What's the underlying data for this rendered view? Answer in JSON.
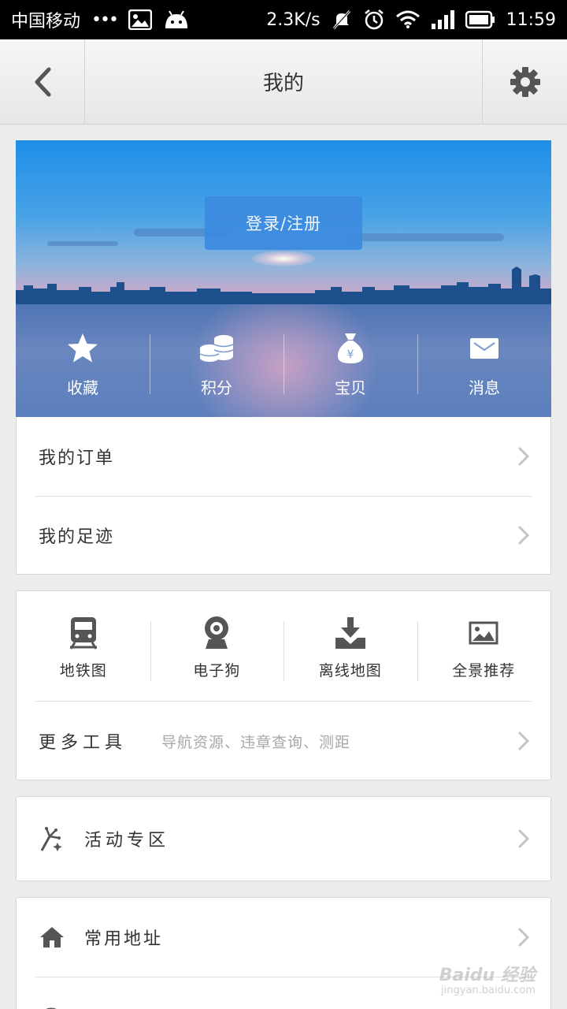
{
  "status_bar": {
    "carrier": "中国移动",
    "dots": "•••",
    "speed": "2.3K/s",
    "time": "11:59"
  },
  "header": {
    "title": "我的"
  },
  "banner": {
    "login_label": "登录/注册",
    "quick_items": [
      {
        "label": "收藏",
        "icon": "star-icon"
      },
      {
        "label": "积分",
        "icon": "coins-icon"
      },
      {
        "label": "宝贝",
        "icon": "money-bag-icon"
      },
      {
        "label": "消息",
        "icon": "mail-icon"
      }
    ]
  },
  "orders_card": {
    "items": [
      {
        "label": "我的订单"
      },
      {
        "label": "我的足迹"
      }
    ]
  },
  "tools_card": {
    "tools": [
      {
        "label": "地铁图",
        "icon": "subway-icon"
      },
      {
        "label": "电子狗",
        "icon": "camera-icon"
      },
      {
        "label": "离线地图",
        "icon": "download-icon"
      },
      {
        "label": "全景推荐",
        "icon": "panorama-icon"
      }
    ],
    "more_label": "更多工具",
    "more_sub": "导航资源、违章查询、测距"
  },
  "activity_card": {
    "label": "活动专区",
    "icon": "fireworks-icon"
  },
  "address_card": {
    "items": [
      {
        "label": "常用地址",
        "icon": "home-icon"
      },
      {
        "label": "",
        "icon": "clock-icon"
      }
    ]
  },
  "watermark": {
    "brand": "Baidu 经验",
    "url": "jingyan.baidu.com"
  },
  "colors": {
    "login_button": "#3c8be0",
    "background": "#ececec",
    "icon_gray": "#555555"
  }
}
